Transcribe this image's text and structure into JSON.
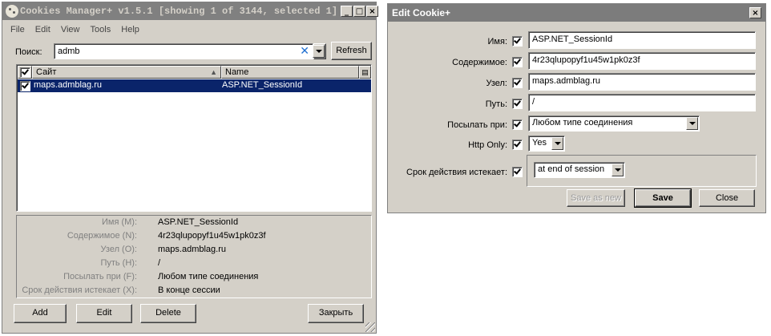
{
  "cm": {
    "title": "Cookies Manager+ v1.5.1 [showing 1 of 3144, selected 1]",
    "menu": [
      "File",
      "Edit",
      "View",
      "Tools",
      "Help"
    ],
    "search_label": "Поиск:",
    "search_value": "admb",
    "refresh_label": "Refresh",
    "columns": {
      "site": "Сайт",
      "name": "Name"
    },
    "rows": [
      {
        "site": "maps.admblag.ru",
        "name": "ASP.NET_SessionId"
      }
    ],
    "info": [
      {
        "label": "Имя (M):",
        "value": "ASP.NET_SessionId"
      },
      {
        "label": "Содержимое (N):",
        "value": "4r23qlupopyf1u45w1pk0z3f"
      },
      {
        "label": "Узел (O):",
        "value": "maps.admblag.ru"
      },
      {
        "label": "Путь (H):",
        "value": "/"
      },
      {
        "label": "Посылать при (F):",
        "value": "Любом типе соединения"
      },
      {
        "label": "Срок действия истекает (X):",
        "value": "В конце сессии"
      }
    ],
    "buttons": {
      "add": "Add",
      "edit": "Edit",
      "delete": "Delete",
      "close": "Закрыть"
    }
  },
  "edit": {
    "title": "Edit Cookie+",
    "fields": {
      "name_label": "Имя:",
      "name_value": "ASP.NET_SessionId",
      "content_label": "Содержимое:",
      "content_value": "4r23qlupopyf1u45w1pk0z3f",
      "host_label": "Узел:",
      "host_value": "maps.admblag.ru",
      "path_label": "Путь:",
      "path_value": "/",
      "send_label": "Посылать при:",
      "send_value": "Любом типе соединения",
      "httponly_label": "Http Only:",
      "httponly_value": "Yes",
      "expires_label": "Срок действия истекает:",
      "expires_value": "at end of session"
    },
    "buttons": {
      "save_as_new": "Save as new",
      "save": "Save",
      "close": "Close"
    }
  }
}
